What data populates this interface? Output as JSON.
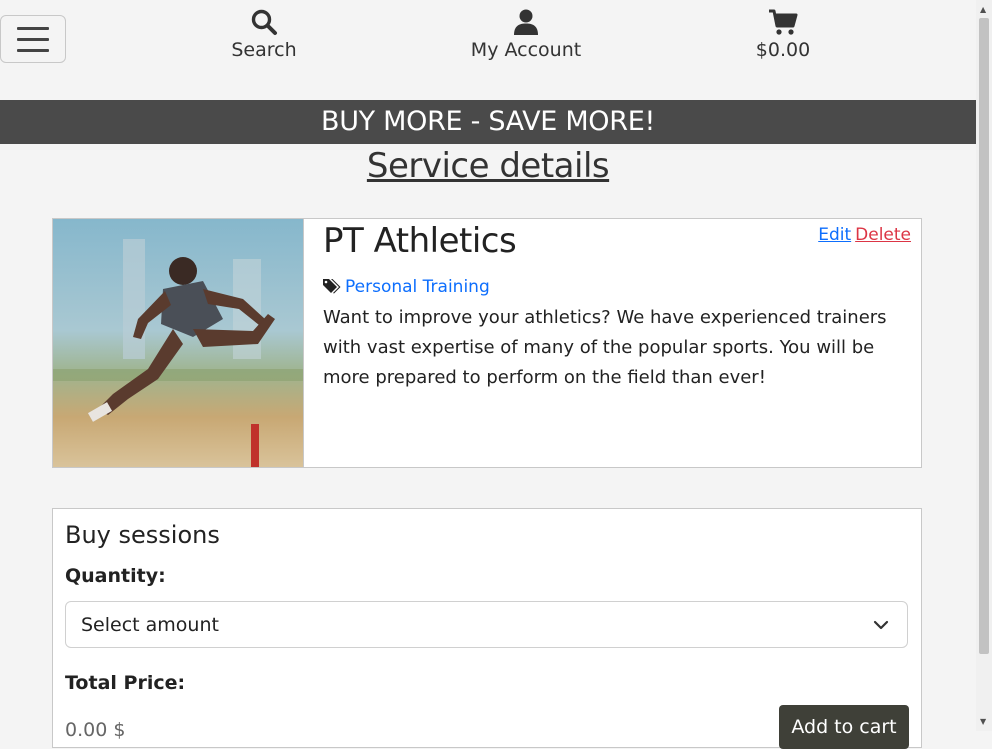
{
  "nav": {
    "menu_icon": "hamburger-icon",
    "search": {
      "icon": "search-icon",
      "label": "Search"
    },
    "account": {
      "icon": "user-icon",
      "label": "My Account"
    },
    "cart": {
      "icon": "cart-icon",
      "label": "$0.00"
    }
  },
  "banner": {
    "text": "BUY MORE - SAVE MORE!",
    "bg": "#4a4a4a"
  },
  "page": {
    "title": "Service details"
  },
  "service": {
    "name": "PT Athletics",
    "edit_label": "Edit",
    "delete_label": "Delete",
    "category_icon": "tags-icon",
    "category": "Personal Training",
    "description": "Want to improve your athletics? We have experienced trainers with vast expertise of many of the popular sports. You will be more prepared to perform on the field than ever!"
  },
  "purchase": {
    "heading": "Buy sessions",
    "quantity_label": "Quantity:",
    "quantity_selected": "Select amount",
    "total_label": "Total Price:",
    "total_value": "0.00 $",
    "add_to_cart_label": "Add to cart"
  },
  "colors": {
    "link": "#0d6efd",
    "danger": "#dc3545",
    "button": "#3f4038"
  }
}
